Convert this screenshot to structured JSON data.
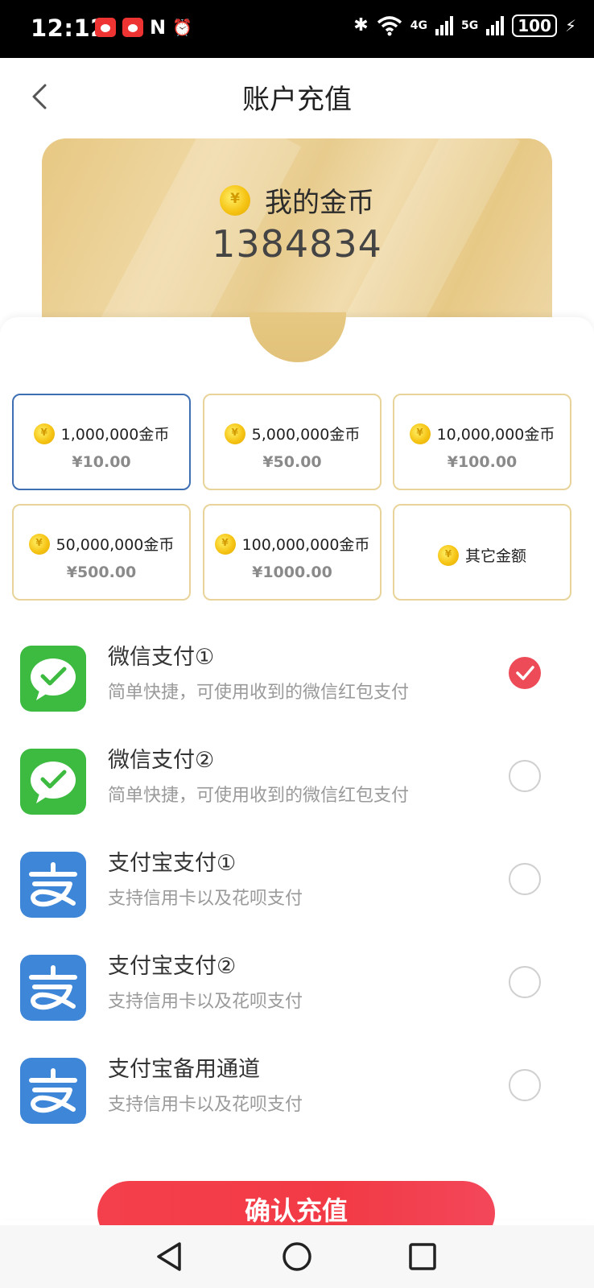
{
  "status_bar": {
    "time": "12:12",
    "nfc": "N",
    "alarm": "⏰",
    "bluetooth": "✱",
    "net1": "4G",
    "net2": "5G",
    "battery": "100",
    "charging": "⚡"
  },
  "header": {
    "title": "账户充值"
  },
  "card": {
    "title": "我的金币",
    "amount": "1384834"
  },
  "amounts": [
    {
      "label": "1,000,000金币",
      "price": "¥10.00",
      "selected": true
    },
    {
      "label": "5,000,000金币",
      "price": "¥50.00",
      "selected": false
    },
    {
      "label": "10,000,000金币",
      "price": "¥100.00",
      "selected": false
    },
    {
      "label": "50,000,000金币",
      "price": "¥500.00",
      "selected": false
    },
    {
      "label": "100,000,000金币",
      "price": "¥1000.00",
      "selected": false
    },
    {
      "label": "其它金额",
      "price": "",
      "selected": false
    }
  ],
  "payments": [
    {
      "title": "微信支付①",
      "desc": "简单快捷，可使用收到的微信红包支付",
      "icon": "wechat-pay-icon",
      "checked": true
    },
    {
      "title": "微信支付②",
      "desc": "简单快捷，可使用收到的微信红包支付",
      "icon": "wechat-pay-icon",
      "checked": false
    },
    {
      "title": "支付宝支付①",
      "desc": "支持信用卡以及花呗支付",
      "icon": "alipay-icon",
      "checked": false
    },
    {
      "title": "支付宝支付②",
      "desc": "支持信用卡以及花呗支付",
      "icon": "alipay-icon",
      "checked": false
    },
    {
      "title": "支付宝备用通道",
      "desc": "支持信用卡以及花呗支付",
      "icon": "alipay-icon",
      "checked": false
    }
  ],
  "confirm_label": "确认充值",
  "colors": {
    "accent": "#F23A45",
    "gold": "#E8CC8E",
    "selected_border": "#3F6FB3",
    "wechat": "#3DBB41",
    "alipay": "#3E86D8"
  }
}
